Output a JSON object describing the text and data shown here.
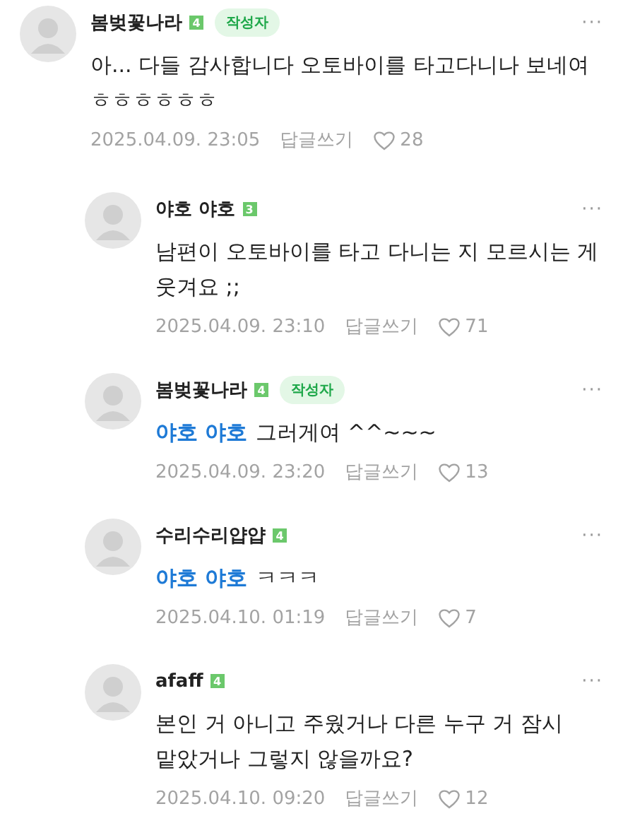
{
  "comments": [
    {
      "author": "봄벚꽃나라",
      "level": "4",
      "writer_badge": "작성자",
      "text": "아... 다들 감사합니다 오토바이를 타고다니나 보네여 ㅎㅎㅎㅎㅎㅎ",
      "date": "2025.04.09. 23:05",
      "reply_label": "답글쓰기",
      "likes": "28",
      "more": "···",
      "children": [
        {
          "author": "야호 야호",
          "level": "3",
          "text": "남편이 오토바이를 타고 다니는 지 모르시는 게 웃겨요 ;;",
          "date": "2025.04.09. 23:10",
          "reply_label": "답글쓰기",
          "likes": "71",
          "more": "···"
        },
        {
          "author": "봄벚꽃나라",
          "level": "4",
          "writer_badge": "작성자",
          "mention": "야호 야호",
          "text": "그러게여 ^^~~~",
          "date": "2025.04.09. 23:20",
          "reply_label": "답글쓰기",
          "likes": "13",
          "more": "···"
        },
        {
          "author": "수리수리얍얍",
          "level": "4",
          "mention": "야호 야호",
          "text": "ㅋㅋㅋ",
          "date": "2025.04.10. 01:19",
          "reply_label": "답글쓰기",
          "likes": "7",
          "more": "···"
        },
        {
          "author": "afaff",
          "level": "4",
          "text": "본인 거 아니고 주웠거나 다른 누구 거 잠시 맡았거나 그렇지 않을까요?",
          "date": "2025.04.10. 09:20",
          "reply_label": "답글쓰기",
          "likes": "12",
          "more": "···"
        }
      ]
    }
  ]
}
